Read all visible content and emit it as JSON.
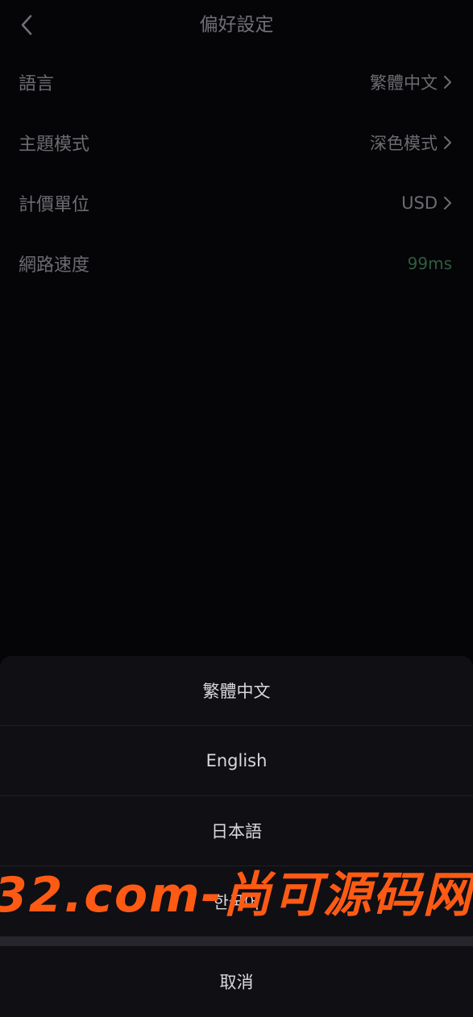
{
  "header": {
    "title": "偏好設定",
    "back_icon": "chevron-left-icon"
  },
  "settings": {
    "items": [
      {
        "label": "語言",
        "value": "繁體中文",
        "has_chevron": true
      },
      {
        "label": "主題模式",
        "value": "深色模式",
        "has_chevron": true
      },
      {
        "label": "計價單位",
        "value": "USD",
        "has_chevron": true
      },
      {
        "label": "網路速度",
        "value": "99ms",
        "has_chevron": false,
        "value_color": "#2f5d3f"
      }
    ]
  },
  "language_sheet": {
    "options": [
      "繁體中文",
      "English",
      "日本語",
      "한국어"
    ],
    "cancel_label": "取消"
  },
  "watermark": {
    "text": "32.com-尚可源码网",
    "color": "#ff5a14"
  }
}
